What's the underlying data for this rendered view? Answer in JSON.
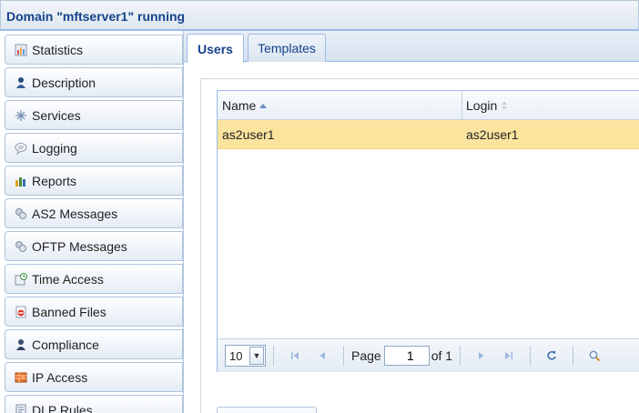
{
  "window": {
    "title": "Domain \"mftserver1\" running"
  },
  "sidebar": {
    "items": [
      {
        "label": "Statistics",
        "icon": "statistics-icon"
      },
      {
        "label": "Description",
        "icon": "user-icon"
      },
      {
        "label": "Services",
        "icon": "services-icon"
      },
      {
        "label": "Logging",
        "icon": "logging-icon"
      },
      {
        "label": "Reports",
        "icon": "reports-icon"
      },
      {
        "label": "AS2 Messages",
        "icon": "as2-messages-icon"
      },
      {
        "label": "OFTP Messages",
        "icon": "oftp-messages-icon"
      },
      {
        "label": "Time Access",
        "icon": "time-access-icon"
      },
      {
        "label": "Banned Files",
        "icon": "banned-files-icon"
      },
      {
        "label": "Compliance",
        "icon": "compliance-icon"
      },
      {
        "label": "IP Access",
        "icon": "ip-access-icon"
      },
      {
        "label": "DLP Rules",
        "icon": "dlp-rules-icon"
      }
    ]
  },
  "tabs": [
    {
      "label": "Users",
      "active": true
    },
    {
      "label": "Templates",
      "active": false
    }
  ],
  "grid": {
    "columns": [
      {
        "label": "Name",
        "sort": "ascending"
      },
      {
        "label": "Login",
        "sort": "none"
      }
    ],
    "rows": [
      {
        "name": "as2user1",
        "login": "as2user1",
        "selected": true
      }
    ]
  },
  "pager": {
    "page_size": "10",
    "page_label": "Page",
    "current_page": "1",
    "of_label": "of 1"
  },
  "colors": {
    "header_text": "#15428b",
    "selected_row": "#fbe49e",
    "border": "#99bbe8"
  }
}
